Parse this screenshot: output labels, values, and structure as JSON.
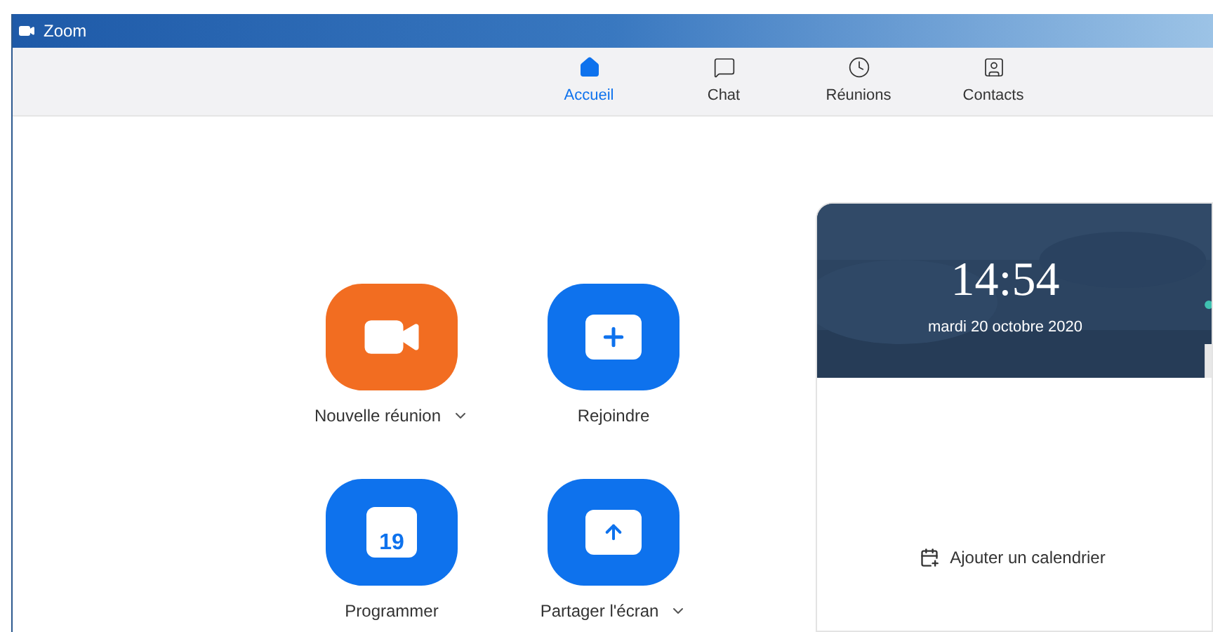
{
  "window": {
    "title": "Zoom"
  },
  "tabs": [
    {
      "label": "Accueil",
      "kind": "home",
      "selected": true
    },
    {
      "label": "Chat",
      "kind": "chat",
      "selected": false
    },
    {
      "label": "Réunions",
      "kind": "clock",
      "selected": false
    },
    {
      "label": "Contacts",
      "kind": "contacts",
      "selected": false
    }
  ],
  "actions": [
    {
      "label": "Nouvelle réunion",
      "kind": "video",
      "has_menu": true
    },
    {
      "label": "Rejoindre",
      "kind": "join",
      "has_menu": false
    },
    {
      "label": "Programmer",
      "kind": "schedule",
      "icon_text": "19",
      "has_menu": false
    },
    {
      "label": "Partager l'écran",
      "kind": "share",
      "has_menu": true
    }
  ],
  "clock_card": {
    "time": "14:54",
    "date": "mardi 20 octobre 2020",
    "add_calendar": "Ajouter un calendrier"
  }
}
